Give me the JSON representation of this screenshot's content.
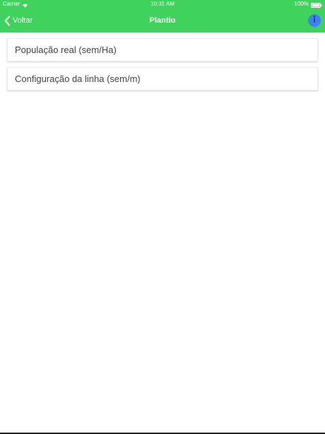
{
  "status_bar": {
    "carrier": "Carrier",
    "time": "10:31 AM",
    "battery": "100%"
  },
  "nav": {
    "back_label": "Voltar",
    "title": "Plantio",
    "info_icon": "info-icon"
  },
  "list": {
    "items": [
      {
        "label": "População real (sem/Ha)"
      },
      {
        "label": "Configuração da linha (sem/m)"
      }
    ]
  },
  "colors": {
    "header_green": "#3fd25d",
    "info_blue": "#3b82f6",
    "text": "#444444"
  }
}
